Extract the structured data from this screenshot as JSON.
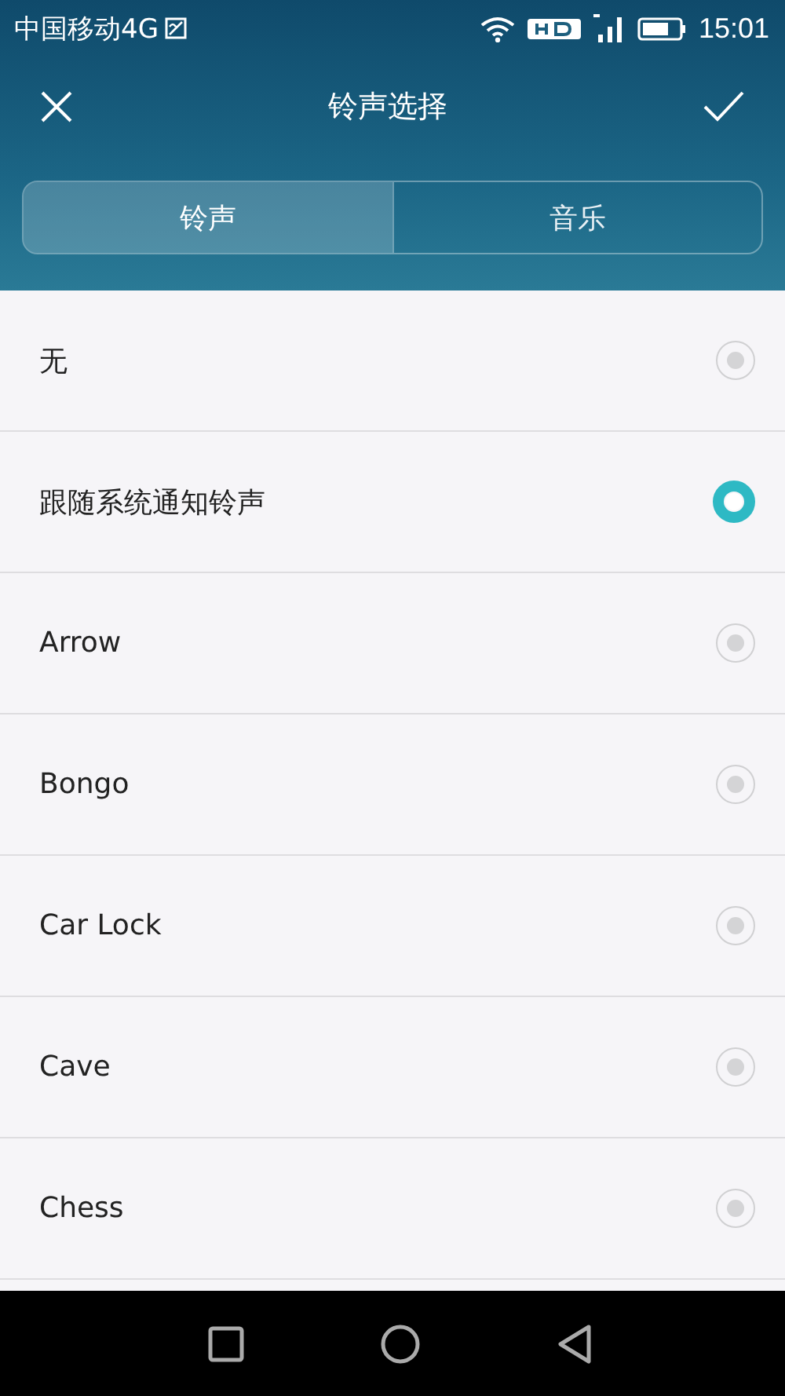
{
  "status_bar": {
    "carrier": "中国移动4G",
    "time": "15:01"
  },
  "toolbar": {
    "title": "铃声选择"
  },
  "tabs": [
    {
      "label": "铃声",
      "selected": true
    },
    {
      "label": "音乐",
      "selected": false
    }
  ],
  "ringtones": [
    {
      "name": "无",
      "selected": false
    },
    {
      "name": "跟随系统通知铃声",
      "selected": true
    },
    {
      "name": "Arrow",
      "selected": false
    },
    {
      "name": "Bongo",
      "selected": false
    },
    {
      "name": "Car Lock",
      "selected": false
    },
    {
      "name": "Cave",
      "selected": false
    },
    {
      "name": "Chess",
      "selected": false
    }
  ]
}
